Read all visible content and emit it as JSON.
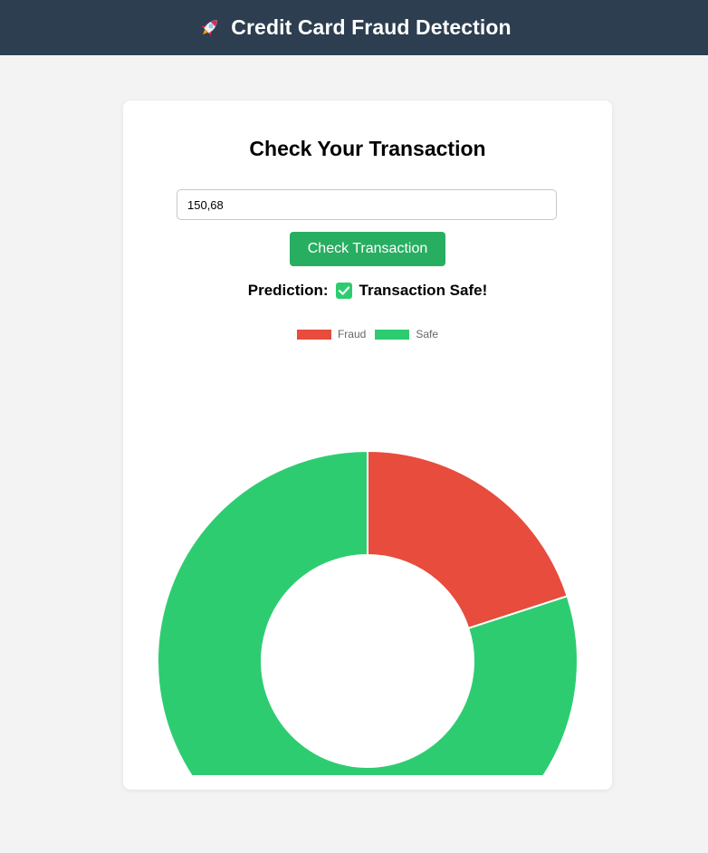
{
  "header": {
    "title": "Credit Card Fraud Detection",
    "icon": "rocket-icon"
  },
  "card": {
    "heading": "Check Your Transaction",
    "input": {
      "value": "150,68",
      "placeholder": ""
    },
    "button_label": "Check Transaction",
    "prediction": {
      "label": "Prediction:",
      "icon": "check-mark-icon",
      "result": "Transaction Safe!"
    }
  },
  "colors": {
    "header_bg": "#2c3e50",
    "button_bg": "#27ae60",
    "fraud": "#e74c3c",
    "safe": "#2ecc71",
    "check_icon": "#2ecc71"
  },
  "chart_data": {
    "type": "pie",
    "variant": "doughnut",
    "categories": [
      "Fraud",
      "Safe"
    ],
    "values": [
      20,
      80
    ],
    "colors": [
      "#e74c3c",
      "#2ecc71"
    ],
    "legend_position": "top"
  }
}
